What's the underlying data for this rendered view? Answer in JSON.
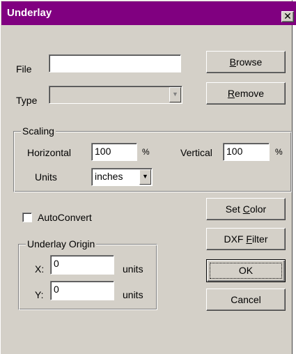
{
  "window": {
    "title": "Underlay",
    "close_glyph": "✕"
  },
  "file": {
    "label": "File",
    "value": ""
  },
  "type": {
    "label": "Type",
    "value": "",
    "arrow": "▼"
  },
  "buttons": {
    "browse": {
      "pre": "",
      "key": "B",
      "post": "rowse"
    },
    "remove": {
      "pre": "",
      "key": "R",
      "post": "emove"
    },
    "set_color": {
      "pre": "Set ",
      "key": "C",
      "post": "olor"
    },
    "dxf_filter": {
      "pre": "DXF ",
      "key": "F",
      "post": "ilter"
    },
    "ok": "OK",
    "cancel": "Cancel"
  },
  "scaling": {
    "title": "Scaling",
    "horizontal_label": "Horizontal",
    "horizontal_value": "100",
    "horizontal_unit": "%",
    "vertical_label": "Vertical",
    "vertical_value": "100",
    "vertical_unit": "%",
    "units_label": "Units",
    "units_value": "inches",
    "units_arrow": "▼"
  },
  "autoconvert": {
    "label": "AutoConvert",
    "checked": false
  },
  "origin": {
    "title": "Underlay Origin",
    "x_label": "X:",
    "x_value": "0",
    "x_unit": "units",
    "y_label": "Y:",
    "y_value": "0",
    "y_unit": "units"
  }
}
